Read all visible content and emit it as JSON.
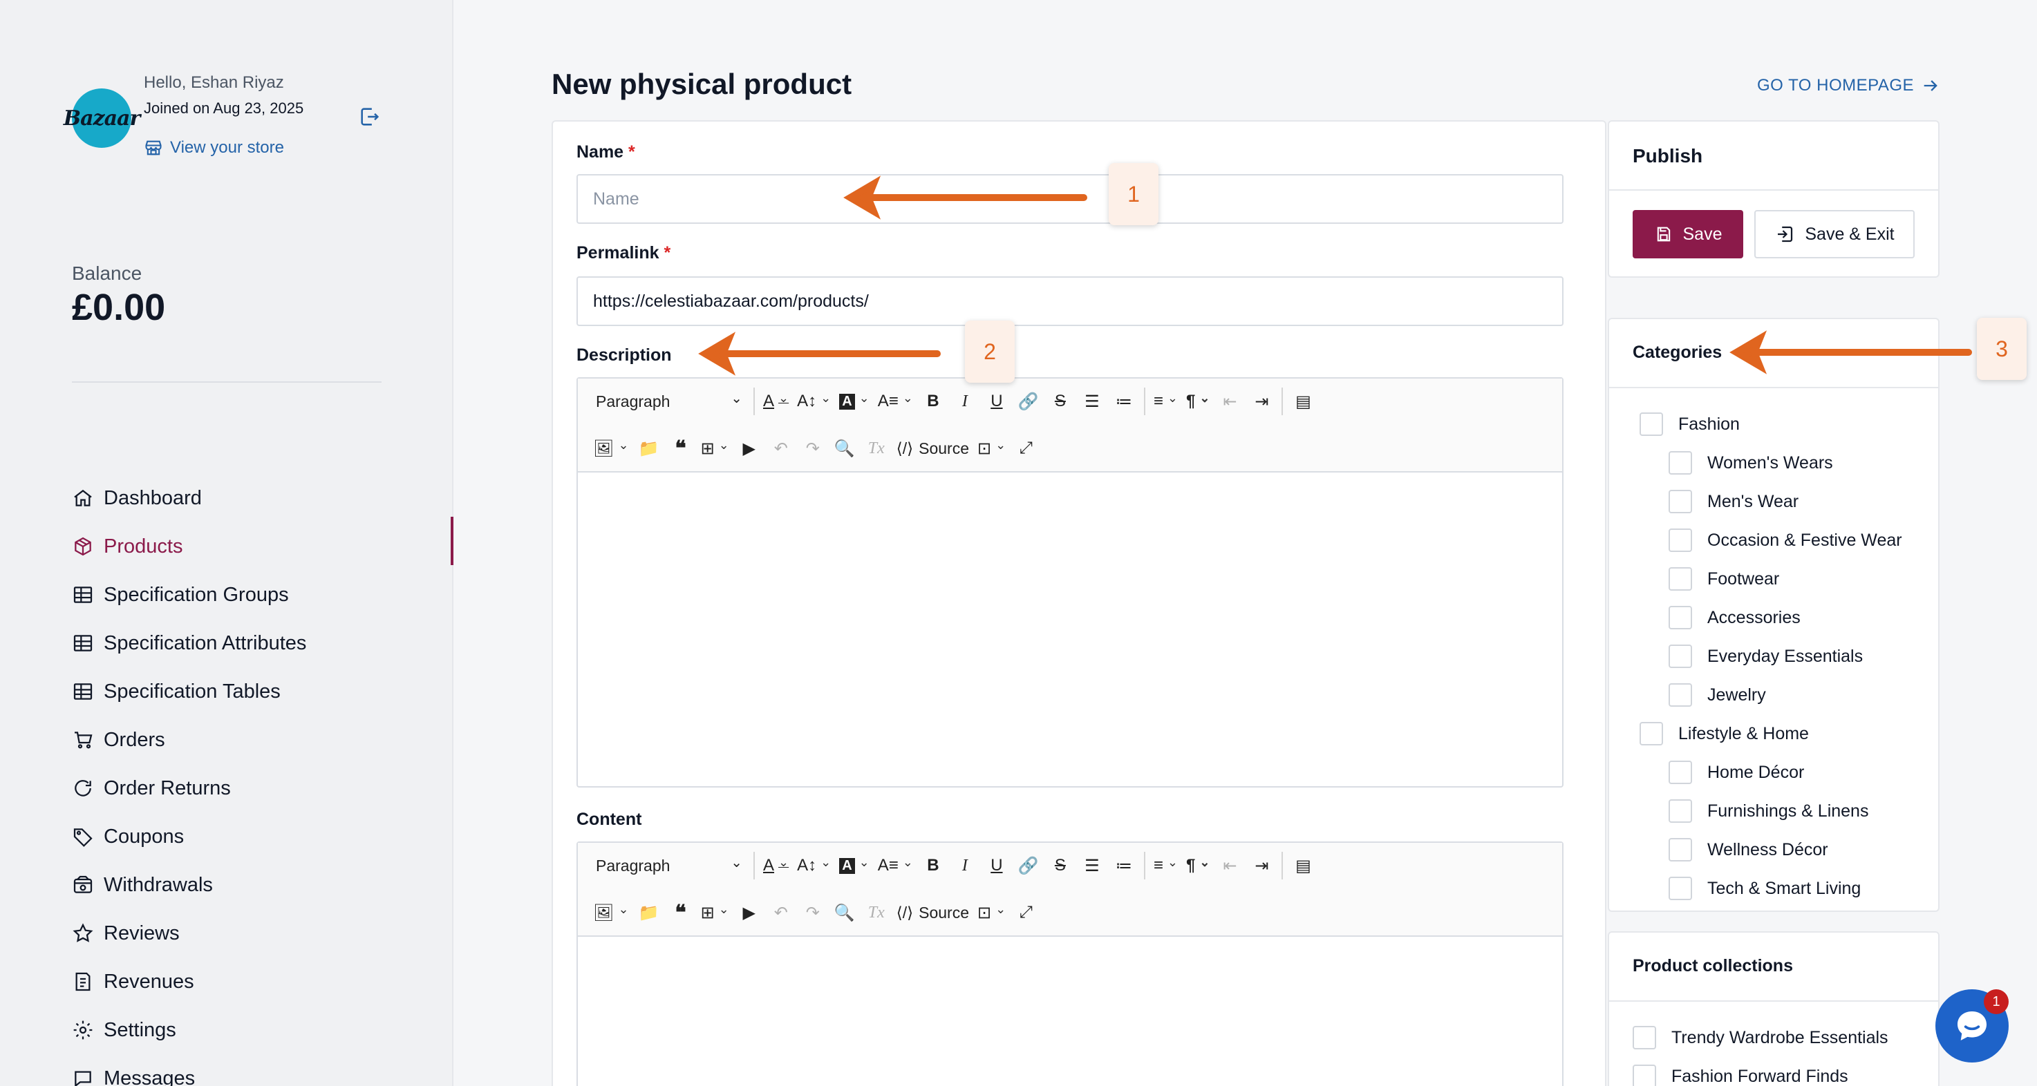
{
  "user": {
    "avatar_text": "Bazaar",
    "greeting": "Hello, Eshan Riyaz",
    "joined": "Joined on Aug 23, 2025",
    "store_link": "View your store"
  },
  "balance": {
    "label": "Balance",
    "value": "£0.00"
  },
  "nav": [
    {
      "label": "Dashboard",
      "icon": "home-icon"
    },
    {
      "label": "Products",
      "icon": "box-icon",
      "active": true
    },
    {
      "label": "Specification Groups",
      "icon": "table-icon"
    },
    {
      "label": "Specification Attributes",
      "icon": "table-icon"
    },
    {
      "label": "Specification Tables",
      "icon": "table-icon"
    },
    {
      "label": "Orders",
      "icon": "cart-icon"
    },
    {
      "label": "Order Returns",
      "icon": "refresh-icon"
    },
    {
      "label": "Coupons",
      "icon": "tag-icon"
    },
    {
      "label": "Withdrawals",
      "icon": "wallet-icon"
    },
    {
      "label": "Reviews",
      "icon": "star-icon"
    },
    {
      "label": "Revenues",
      "icon": "receipt-icon"
    },
    {
      "label": "Settings",
      "icon": "gear-icon"
    },
    {
      "label": "Messages",
      "icon": "chat-icon"
    }
  ],
  "page": {
    "title": "New physical product",
    "home_link": "GO TO HOMEPAGE"
  },
  "form": {
    "name_label": "Name",
    "name_placeholder": "Name",
    "permalink_label": "Permalink",
    "permalink_value": "https://celestiabazaar.com/products/",
    "description_label": "Description",
    "content_label": "Content",
    "required_mark": "*"
  },
  "editor": {
    "paragraph": "Paragraph",
    "source": "Source"
  },
  "publish": {
    "title": "Publish",
    "save": "Save",
    "save_exit": "Save & Exit"
  },
  "categories": {
    "title": "Categories",
    "items": [
      {
        "label": "Fashion",
        "level": 0
      },
      {
        "label": "Women's Wears",
        "level": 1
      },
      {
        "label": "Men's Wear",
        "level": 1
      },
      {
        "label": "Occasion & Festive Wear",
        "level": 1
      },
      {
        "label": "Footwear",
        "level": 1
      },
      {
        "label": "Accessories",
        "level": 1
      },
      {
        "label": "Everyday Essentials",
        "level": 1
      },
      {
        "label": "Jewelry",
        "level": 1
      },
      {
        "label": "Lifestyle & Home",
        "level": 0
      },
      {
        "label": "Home Décor",
        "level": 1
      },
      {
        "label": "Furnishings & Linens",
        "level": 1
      },
      {
        "label": "Wellness Décor",
        "level": 1
      },
      {
        "label": "Tech & Smart Living",
        "level": 1
      }
    ]
  },
  "collections": {
    "title": "Product collections",
    "items": [
      "Trendy Wardrobe Essentials",
      "Fashion Forward Finds"
    ]
  },
  "annotations": [
    "1",
    "2",
    "3"
  ],
  "chat": {
    "unread": "1"
  },
  "colors": {
    "brand": "#8b1a4a",
    "link": "#2463a8",
    "annotation": "#e0651f"
  }
}
